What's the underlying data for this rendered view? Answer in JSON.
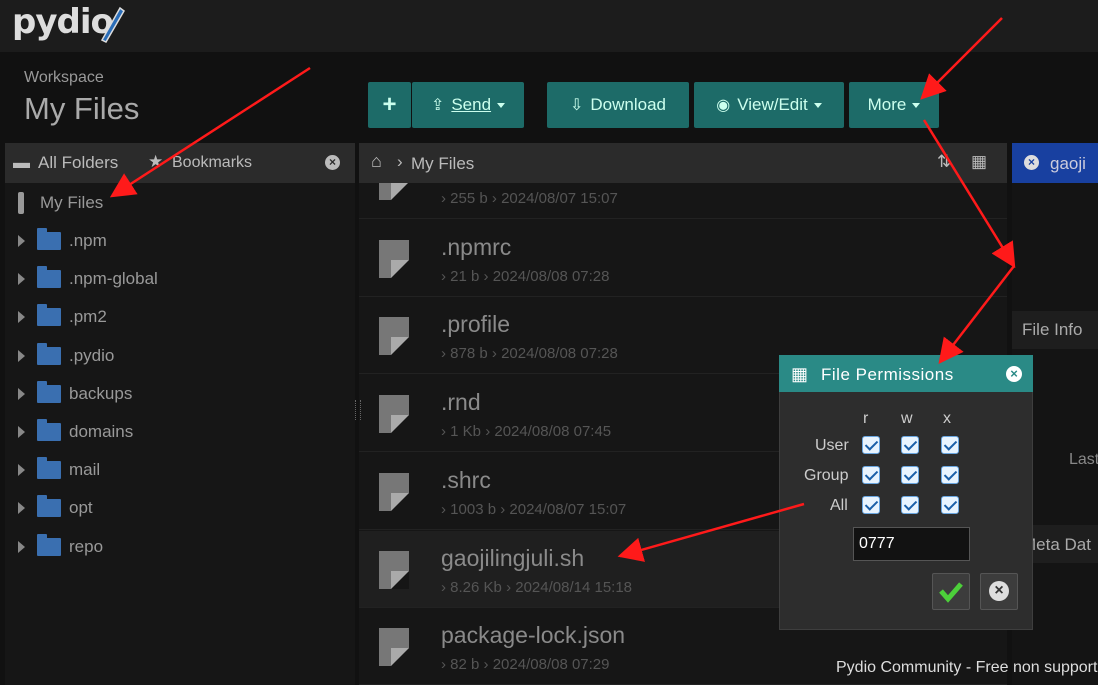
{
  "app": {
    "logo_text": "pydio"
  },
  "workspace": {
    "label": "Workspace",
    "title": "My Files"
  },
  "toolbar": {
    "add_icon": "plus-icon",
    "send_label": "Send",
    "download_label": "Download",
    "view_edit_label": "View/Edit",
    "more_label": "More"
  },
  "left_panel": {
    "tab_folders": "All Folders",
    "tab_bookmarks": "Bookmarks",
    "root": "My Files",
    "folders": [
      ".npm",
      ".npm-global",
      ".pm2",
      ".pydio",
      "backups",
      "domains",
      "mail",
      "opt",
      "repo"
    ]
  },
  "breadcrumb": {
    "current": "My Files"
  },
  "files": [
    {
      "name": "",
      "size": "255 b",
      "date": "2024/08/07 15:07"
    },
    {
      "name": ".npmrc",
      "size": "21 b",
      "date": "2024/08/08 07:28"
    },
    {
      "name": ".profile",
      "size": "878 b",
      "date": "2024/08/08 07:28"
    },
    {
      "name": ".rnd",
      "size": "1 Kb",
      "date": "2024/08/08 07:45"
    },
    {
      "name": ".shrc",
      "size": "1003 b",
      "date": "2024/08/07 15:07"
    },
    {
      "name": "gaojilingjuli.sh",
      "size": "8.26 Kb",
      "date": "2024/08/14 15:18"
    },
    {
      "name": "package-lock.json",
      "size": "82 b",
      "date": "2024/08/08 07:29"
    }
  ],
  "right_panel": {
    "tab": "gaoji",
    "file_info": "File Info",
    "last": "Last",
    "meta": "Meta Dat"
  },
  "dialog": {
    "title": "File Permissions",
    "cols": [
      "r",
      "w",
      "x"
    ],
    "rows": [
      "User",
      "Group",
      "All"
    ],
    "value": "0777"
  },
  "footer": "Pydio Community - Free non supporte",
  "colors": {
    "accent": "#1d6b68",
    "dialog_header": "#2a8a86",
    "annotation": "#ff1a1a"
  }
}
